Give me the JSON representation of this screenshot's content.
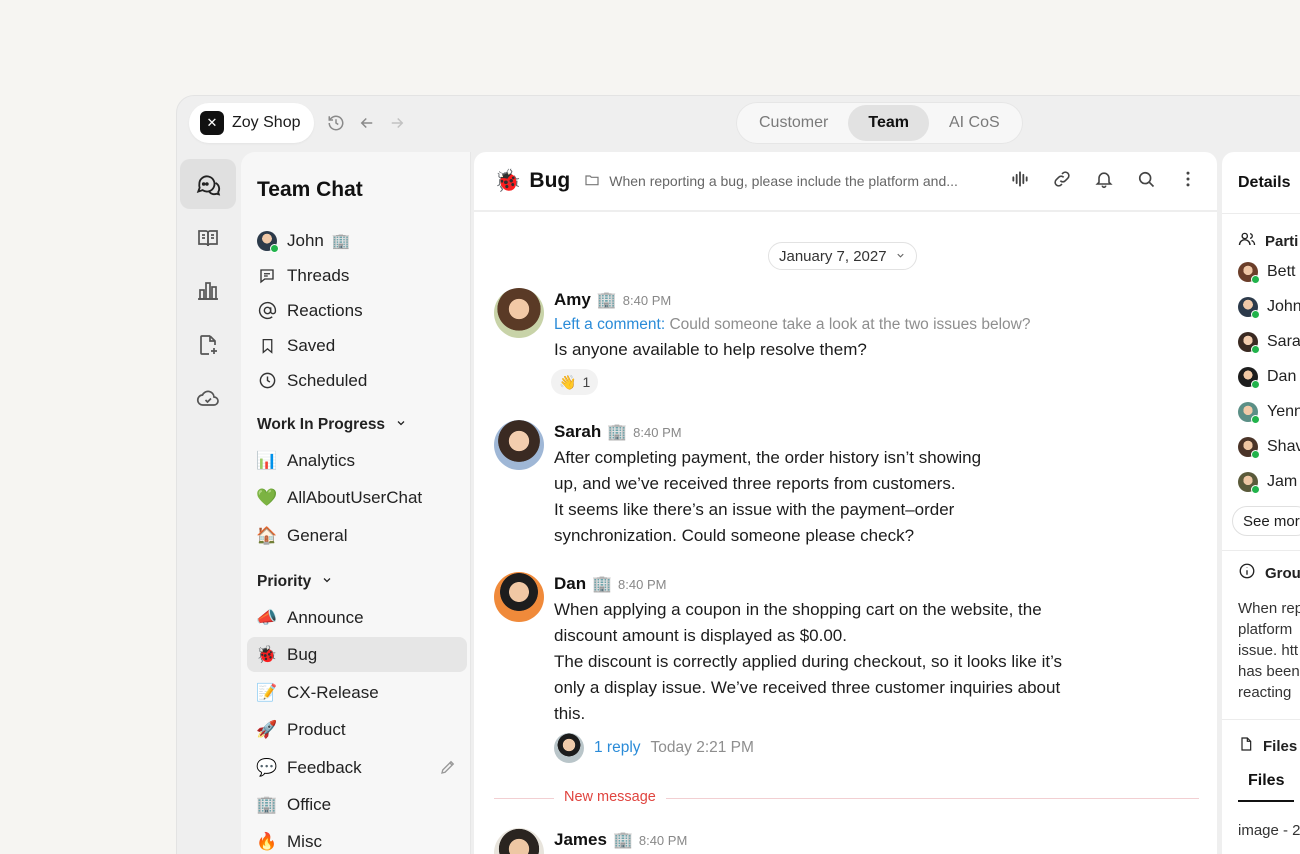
{
  "workspace": {
    "name": "Zoy Shop",
    "logo_icon": "zoy-logo"
  },
  "top_tabs": [
    {
      "label": "Customer",
      "active": false
    },
    {
      "label": "Team",
      "active": true
    },
    {
      "label": "AI CoS",
      "active": false
    }
  ],
  "sidebar": {
    "title": "Team Chat",
    "top_items": [
      {
        "label": "John",
        "suffix": "🏢",
        "icon": "avatar"
      },
      {
        "label": "Threads",
        "icon": "threads-icon"
      },
      {
        "label": "Reactions",
        "icon": "at-icon"
      },
      {
        "label": "Saved",
        "icon": "bookmark-icon"
      },
      {
        "label": "Scheduled",
        "icon": "clock-icon"
      }
    ],
    "section_wip": "Work In Progress",
    "wip_items": [
      {
        "label": "Analytics",
        "emoji": "📊"
      },
      {
        "label": "AllAboutUserChat",
        "emoji": "💚"
      },
      {
        "label": "General",
        "emoji": "🏠"
      }
    ],
    "section_priority": "Priority",
    "priority_items": [
      {
        "label": "Announce",
        "emoji": "📣"
      },
      {
        "label": "Bug",
        "emoji": "🐞",
        "active": true
      },
      {
        "label": "CX-Release",
        "emoji": "📝"
      },
      {
        "label": "Product",
        "emoji": "🚀"
      },
      {
        "label": "Feedback",
        "emoji": "💬"
      },
      {
        "label": "Office",
        "emoji": "🏢"
      },
      {
        "label": "Misc",
        "emoji": "🔥"
      }
    ]
  },
  "channel": {
    "emoji": "🐞",
    "name": "Bug",
    "description": "When reporting a bug, please include the platform and..."
  },
  "date_divider": "January 7, 2027",
  "messages": [
    {
      "author": "Amy",
      "badge": "🏢",
      "time": "8:40 PM",
      "comment_label": "Left a comment:",
      "comment_quote": "Could someone take a look at the two issues below?",
      "lines": [
        "Is anyone available to help resolve them?"
      ],
      "reaction": {
        "emoji": "👋",
        "count": "1"
      }
    },
    {
      "author": "Sarah",
      "badge": "🏢",
      "time": "8:40 PM",
      "lines": [
        "After completing payment, the order history isn’t showing",
        "up, and we’ve received three reports from customers.",
        "It seems like there’s an issue with the payment–order",
        "synchronization. Could someone please check?"
      ]
    },
    {
      "author": "Dan",
      "badge": "🏢",
      "time": "8:40 PM",
      "lines": [
        "When applying a coupon in the shopping cart on the website, the",
        "discount amount is displayed as $0.00.",
        "The discount is correctly applied during checkout, so it looks like it’s",
        "only a display issue. We’ve received three customer inquiries about",
        "this."
      ],
      "thread": {
        "replies": "1 reply",
        "time": "Today 2:21 PM"
      }
    },
    {
      "author": "James",
      "badge": "🏢",
      "time": "8:40 PM"
    }
  ],
  "new_message_label": "New message",
  "details": {
    "title": "Details",
    "participants_label": "Parti",
    "participants": [
      "Bett",
      "John",
      "Sara",
      "Dan",
      "Yenn",
      "Shav",
      "Jam"
    ],
    "see_more": "See mor",
    "group_label": "Grou",
    "group_text": [
      "When rep",
      "platform",
      "issue. htt",
      "has been",
      "reacting"
    ],
    "files_label": "Files",
    "files_tab": "Files",
    "file_name": "image - 2"
  },
  "colors": {
    "link": "#2a8bd8",
    "new_message": "#e0443f",
    "online": "#21b34b"
  }
}
